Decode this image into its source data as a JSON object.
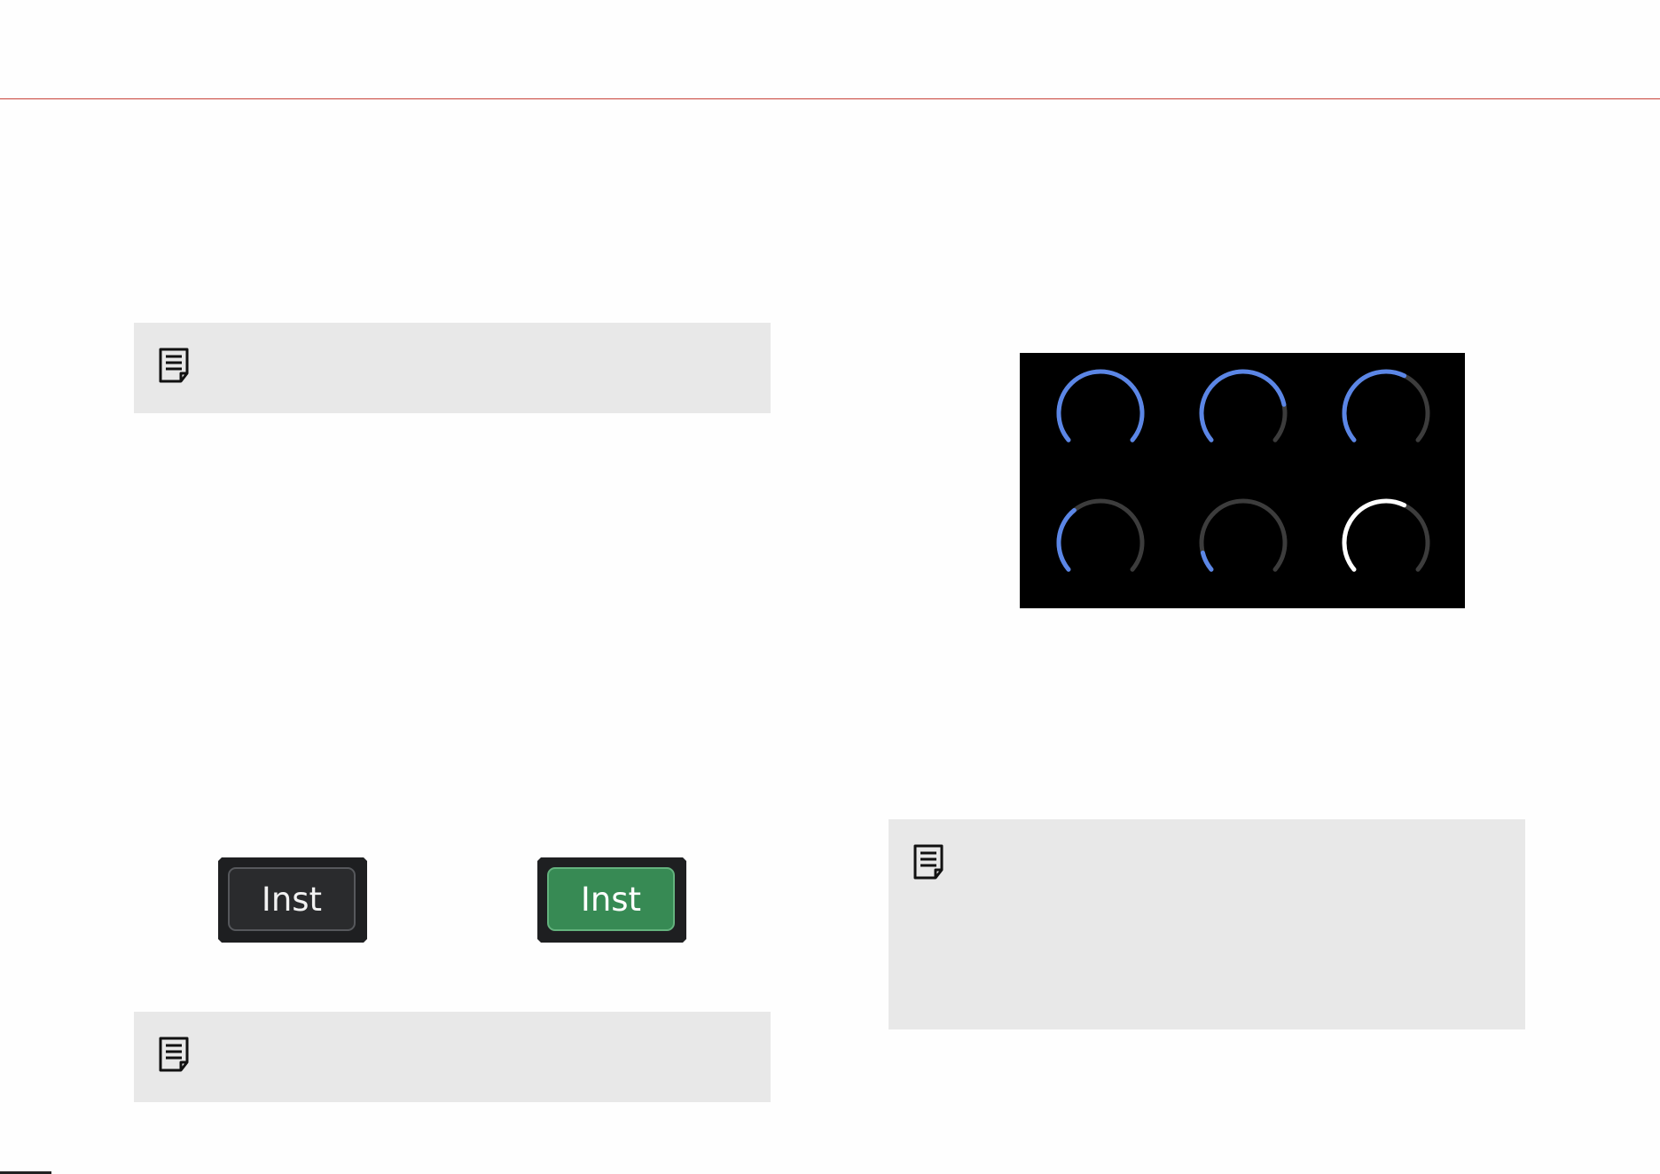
{
  "buttons": {
    "inst_off_label": "Inst",
    "inst_on_label": "Inst"
  },
  "colors": {
    "accent_rule": "#c8433a",
    "note_bg": "#e8e8e8",
    "knob_active": "#5b86e6",
    "knob_track": "#3c3c3c",
    "knob_selected": "#ffffff",
    "inst_on": "#378a54"
  },
  "icons": {
    "note": "note-document-icon"
  },
  "gain_knobs": [
    {
      "state": "active",
      "level": 1.0
    },
    {
      "state": "active",
      "level": 0.8
    },
    {
      "state": "active",
      "level": 0.6
    },
    {
      "state": "active",
      "level": 0.35
    },
    {
      "state": "active",
      "level": 0.1
    },
    {
      "state": "selected",
      "level": 0.6
    }
  ]
}
